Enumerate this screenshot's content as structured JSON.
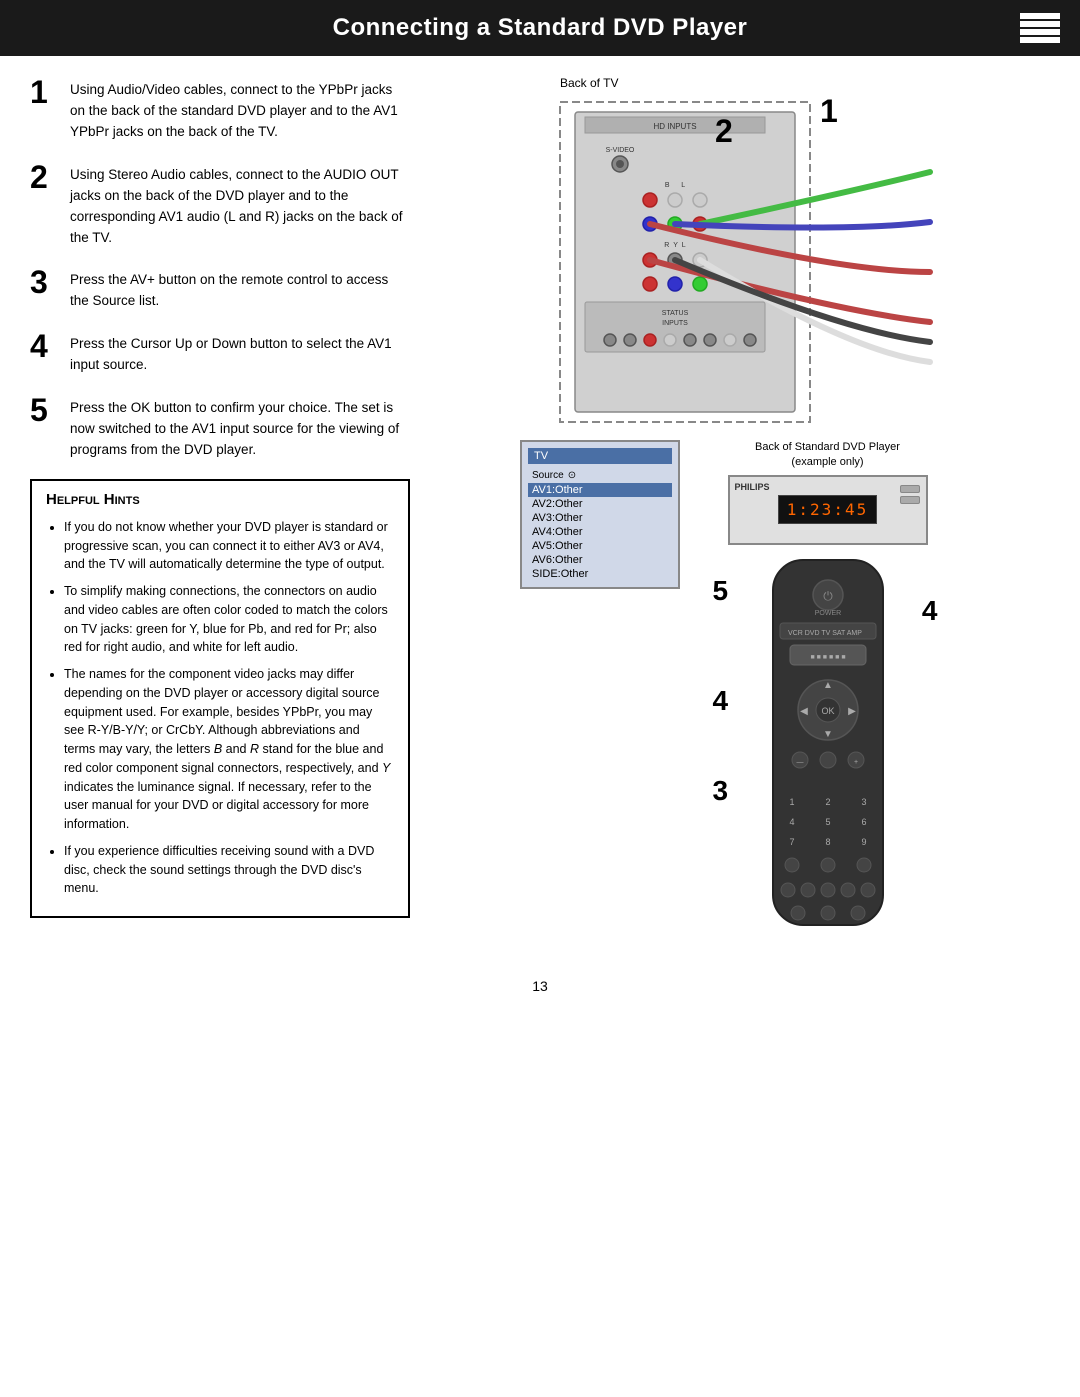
{
  "header": {
    "title": "Connecting a Standard DVD Player"
  },
  "steps": [
    {
      "number": "1",
      "text": "Using Audio/Video cables, connect to the YPbPr jacks on the back of the standard DVD player and to the AV1 YPbPr jacks on the back of the TV."
    },
    {
      "number": "2",
      "text": "Using Stereo Audio cables, connect to the AUDIO OUT jacks on the back of the DVD player and to the corresponding AV1 audio (L and R) jacks on the back of the TV."
    },
    {
      "number": "3",
      "text": "Press the AV+ button on the remote control to access the Source list."
    },
    {
      "number": "4",
      "text": "Press the Cursor Up or Down button to select the AV1 input source."
    },
    {
      "number": "5",
      "text": "Press the OK button to confirm your choice. The set is now switched to the AV1 input source for the viewing of programs from the DVD player."
    }
  ],
  "hints": {
    "title": "Helpful Hints",
    "items": [
      "If you do not know whether your DVD player is standard or progressive scan, you can connect it to either AV3 or AV4, and the TV will automatically determine the type of output.",
      "To simplify making connections, the connectors on audio and video cables are often color coded to match the colors on TV jacks: green for Y, blue for Pb, and red for Pr; also red for right audio, and white for left audio.",
      "The names for the component video jacks may differ depending on the DVD player or accessory digital source equipment used. For example, besides YPbPr, you may see R-Y/B-Y/Y; or CrCbY. Although abbreviations and terms may vary, the letters B and R stand for the blue and red color component signal connectors, respectively, and Y indicates the luminance signal. If necessary, refer to the user manual for your DVD or digital accessory for more information.",
      "If you experience difficulties receiving sound with a DVD disc, check the sound settings through the DVD disc's menu."
    ]
  },
  "diagram": {
    "tv_back_label": "Back of TV",
    "dvd_back_label": "Back of Standard DVD Player\n(example only)",
    "step_numbers_on_diagram": [
      "2",
      "1"
    ],
    "step_numbers_remote": [
      "5",
      "4",
      "4",
      "3"
    ]
  },
  "tv_screen": {
    "header": "TV",
    "source_label": "Source",
    "items": [
      {
        "label": "AV1:Other",
        "active": true
      },
      {
        "label": "AV2:Other",
        "active": false
      },
      {
        "label": "AV3:Other",
        "active": false
      },
      {
        "label": "AV4:Other",
        "active": false
      },
      {
        "label": "AV5:Other",
        "active": false
      },
      {
        "label": "AV6:Other",
        "active": false
      },
      {
        "label": "SIDE:Other",
        "active": false
      }
    ]
  },
  "dvd_display": "1:23:45",
  "page_number": "13"
}
